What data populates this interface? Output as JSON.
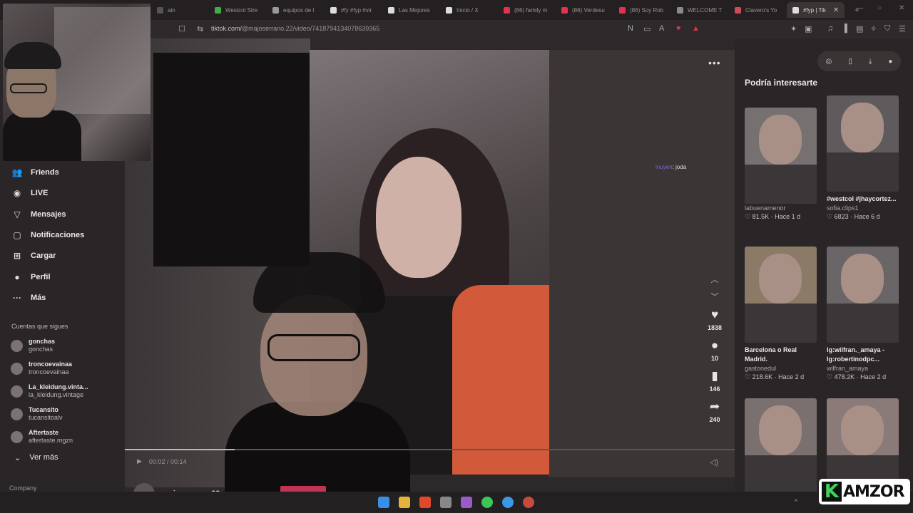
{
  "browser": {
    "tabs": [
      {
        "label": "ain",
        "color": "#555555"
      },
      {
        "label": "Westcol Stre",
        "color": "#3fae49"
      },
      {
        "label": "equipos de l",
        "color": "#9a9a9a"
      },
      {
        "label": "#fy #fyp #vir",
        "color": "#dddddd"
      },
      {
        "label": "Las Mejores",
        "color": "#dddddd"
      },
      {
        "label": "Inicio / X",
        "color": "#dddddd"
      },
      {
        "label": "(86) family m",
        "color": "#e0334f"
      },
      {
        "label": "(86) Verdesu",
        "color": "#e0334f"
      },
      {
        "label": "(86) Soy Rob",
        "color": "#e0334f"
      },
      {
        "label": "WELCOME T",
        "color": "#8a8a8a"
      },
      {
        "label": "Clavero's Yo",
        "color": "#d24a5a"
      },
      {
        "label": "#fyp | Tik",
        "color": "#dddddd"
      }
    ],
    "active_tab_index": 11,
    "url_prefix": "tiktok.com/",
    "url_rest": "@majoserrano.22/video/7418794134078639365"
  },
  "sidebar": {
    "nav": [
      {
        "label": "Friends",
        "icon": "friends-icon",
        "glyph": "👥"
      },
      {
        "label": "LIVE",
        "icon": "live-icon",
        "glyph": "◉"
      },
      {
        "label": "Mensajes",
        "icon": "messages-icon",
        "glyph": "▽"
      },
      {
        "label": "Notificaciones",
        "icon": "notifications-icon",
        "glyph": "▢"
      },
      {
        "label": "Cargar",
        "icon": "upload-icon",
        "glyph": "⊞"
      },
      {
        "label": "Perfil",
        "icon": "profile-icon",
        "glyph": "●"
      },
      {
        "label": "Más",
        "icon": "more-icon",
        "glyph": "···"
      }
    ],
    "following_title": "Cuentas que sigues",
    "following": [
      {
        "name": "gonchas",
        "handle": "gonchas"
      },
      {
        "name": "troncoevainaa",
        "handle": "troncoevainaa"
      },
      {
        "name": "La_kleidung.vinta...",
        "handle": "la_kleidung.vintage"
      },
      {
        "name": "Tucansito",
        "handle": "tucansitoalv"
      },
      {
        "name": "Aftertaste",
        "handle": "aftertaste.mgzn"
      }
    ],
    "see_more": "Ver más",
    "company": "Company"
  },
  "video": {
    "chat_user": "lnuyen",
    "chat_message": ": joda",
    "time": "00:02 / 00:14",
    "progress": 0.18,
    "creator": "majoserrano.22",
    "likes": "1838",
    "comments": "10",
    "saves": "146",
    "shares": "240"
  },
  "right_panel": {
    "title": "Podría interesarte",
    "cards": [
      {
        "title": "",
        "author": "labuenamenor",
        "likes": "81.5K",
        "age": "Hace 1 d"
      },
      {
        "title": "#westcol #jhaycortez...",
        "author": "sofia.clips1",
        "likes": "6823",
        "age": "Hace 6 d"
      },
      {
        "title": "Barcelona o Real Madrid.",
        "author": "gastonedul",
        "likes": "218.6K",
        "age": "Hace 2 d"
      },
      {
        "title": "Ig:wilfran._amaya - Ig:robertinodpc...",
        "author": "wilfran_amaya",
        "likes": "478.2K",
        "age": "Hace 2 d"
      },
      {
        "title": "",
        "author": "",
        "likes": "",
        "age": ""
      },
      {
        "title": "",
        "author": "",
        "likes": "",
        "age": ""
      }
    ]
  },
  "watermark": {
    "letter": "K",
    "text": "AMZOR"
  }
}
